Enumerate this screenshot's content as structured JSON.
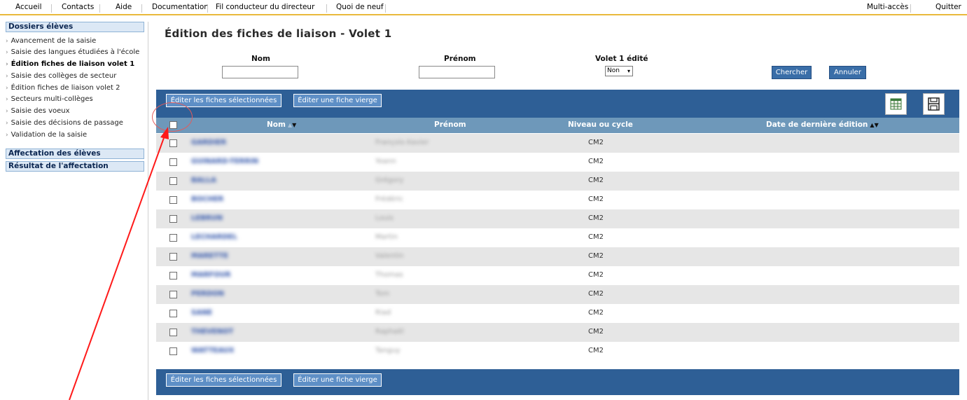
{
  "topnav": {
    "accueil": "Accueil",
    "contacts": "Contacts",
    "aide": "Aide",
    "documentation": "Documentation",
    "fil": "Fil conducteur du directeur",
    "quoi": "Quoi de neuf",
    "multi": "Multi-accès",
    "quitter": "Quitter"
  },
  "sidebar": {
    "dossiers": "Dossiers élèves",
    "items": [
      "Avancement de la saisie",
      "Saisie des langues étudiées à l'école",
      "Édition fiches de liaison volet 1",
      "Saisie des collèges de secteur",
      "Édition fiches de liaison volet 2",
      "Secteurs multi-collèges",
      "Saisie des voeux",
      "Saisie des décisions de passage",
      "Validation de la saisie"
    ],
    "affectation": "Affectation des élèves",
    "resultat": "Résultat de l'affectation"
  },
  "page": {
    "title": "Édition des fiches de liaison - Volet 1"
  },
  "filters": {
    "nom_label": "Nom",
    "nom_value": "",
    "prenom_label": "Prénom",
    "prenom_value": "",
    "volet_label": "Volet 1 édité",
    "volet_value": "Non",
    "chercher": "Chercher",
    "annuler": "Annuler"
  },
  "actions": {
    "edit_selected": "Éditer les fiches sélectionnées",
    "edit_blank": "Éditer une fiche vierge"
  },
  "table": {
    "headers": {
      "nom": "Nom",
      "prenom": "Prénom",
      "niveau": "Niveau ou cycle",
      "date": "Date de dernière édition"
    },
    "rows": [
      {
        "nom": "GARDIER",
        "prenom": "François-Xavier",
        "niveau": "CM2"
      },
      {
        "nom": "GUINARD-TERRIN",
        "prenom": "Yoann",
        "niveau": "CM2"
      },
      {
        "nom": "BALLA",
        "prenom": "Grégory",
        "niveau": "CM2"
      },
      {
        "nom": "BOCHER",
        "prenom": "Frédéric",
        "niveau": "CM2"
      },
      {
        "nom": "LEBRUN",
        "prenom": "Louis",
        "niveau": "CM2"
      },
      {
        "nom": "LECHARDEL",
        "prenom": "Martin",
        "niveau": "CM2"
      },
      {
        "nom": "MARETTE",
        "prenom": "Valentin",
        "niveau": "CM2"
      },
      {
        "nom": "MARFOUR",
        "prenom": "Thomas",
        "niveau": "CM2"
      },
      {
        "nom": "PERDON",
        "prenom": "Tom",
        "niveau": "CM2"
      },
      {
        "nom": "SANE",
        "prenom": "Riad",
        "niveau": "CM2"
      },
      {
        "nom": "THEVENOT",
        "prenom": "Raphaël",
        "niveau": "CM2"
      },
      {
        "nom": "WATTEAUX",
        "prenom": "Tanguy",
        "niveau": "CM2"
      }
    ]
  },
  "icons": {
    "grid": "grid-icon",
    "print": "print-icon",
    "sort": "sort-arrows-icon",
    "dropdown": "chevron-down-icon"
  },
  "colors": {
    "bar": "#2e5f96",
    "header": "#6e98ba",
    "menu_underline": "#e9b93c",
    "annotation": "#e25c5c"
  }
}
